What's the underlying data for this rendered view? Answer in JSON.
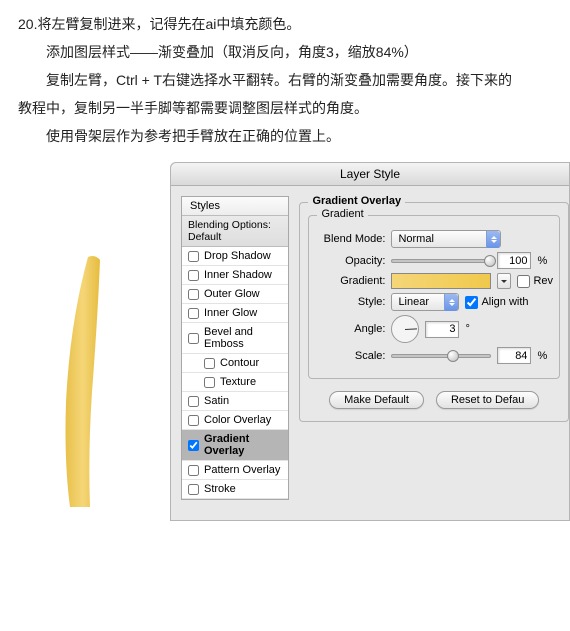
{
  "instructions": {
    "line1": "20.将左臂复制进来，记得先在ai中填充颜色。",
    "line2": "添加图层样式——渐变叠加（取消反向，角度3，缩放84%）",
    "line3": "复制左臂，Ctrl + T右键选择水平翻转。右臂的渐变叠加需要角度。接下来的",
    "line4": "教程中，复制另一半手脚等都需要调整图层样式的角度。",
    "line5": "使用骨架层作为参考把手臂放在正确的位置上。"
  },
  "dialog": {
    "title": "Layer Style",
    "stylesHeader": "Styles",
    "blendingOptions": "Blending Options: Default",
    "items": [
      {
        "label": "Drop Shadow",
        "checked": false,
        "indent": false,
        "selected": false
      },
      {
        "label": "Inner Shadow",
        "checked": false,
        "indent": false,
        "selected": false
      },
      {
        "label": "Outer Glow",
        "checked": false,
        "indent": false,
        "selected": false
      },
      {
        "label": "Inner Glow",
        "checked": false,
        "indent": false,
        "selected": false
      },
      {
        "label": "Bevel and Emboss",
        "checked": false,
        "indent": false,
        "selected": false
      },
      {
        "label": "Contour",
        "checked": false,
        "indent": true,
        "selected": false
      },
      {
        "label": "Texture",
        "checked": false,
        "indent": true,
        "selected": false
      },
      {
        "label": "Satin",
        "checked": false,
        "indent": false,
        "selected": false
      },
      {
        "label": "Color Overlay",
        "checked": false,
        "indent": false,
        "selected": false
      },
      {
        "label": "Gradient Overlay",
        "checked": true,
        "indent": false,
        "selected": true
      },
      {
        "label": "Pattern Overlay",
        "checked": false,
        "indent": false,
        "selected": false
      },
      {
        "label": "Stroke",
        "checked": false,
        "indent": false,
        "selected": false
      }
    ],
    "panel": {
      "heading": "Gradient Overlay",
      "subheading": "Gradient",
      "blendModeLabel": "Blend Mode:",
      "blendModeValue": "Normal",
      "opacityLabel": "Opacity:",
      "opacityValue": "100",
      "pct": "%",
      "gradientLabel": "Gradient:",
      "reverseLabel": "Rev",
      "styleLabel": "Style:",
      "styleValue": "Linear",
      "alignLabel": "Align with",
      "angleLabel": "Angle:",
      "angleValue": "3",
      "deg": "°",
      "scaleLabel": "Scale:",
      "scaleValue": "84",
      "makeDefault": "Make Default",
      "resetDefault": "Reset to Defau"
    }
  }
}
